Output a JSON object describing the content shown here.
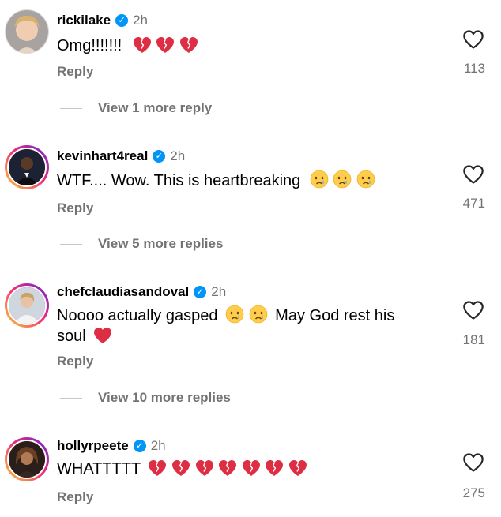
{
  "comments": [
    {
      "username": "rickilake",
      "verified_icon": "verified-badge-icon",
      "time": "2h",
      "text": "Omg!!!!!!!",
      "emoji": "broken-heart-icon",
      "emoji_count": 3,
      "reply_label": "Reply",
      "likes": "113",
      "view_more": "View 1 more reply"
    },
    {
      "username": "kevinhart4real",
      "verified_icon": "verified-badge-icon",
      "time": "2h",
      "text": "WTF.... Wow. This is heartbreaking",
      "emoji": "crying-face-icon",
      "emoji_count": 3,
      "reply_label": "Reply",
      "likes": "471",
      "view_more": "View 5 more replies"
    },
    {
      "username": "chefclaudiasandoval",
      "verified_icon": "verified-badge-icon",
      "time": "2h",
      "text_a": "Noooo actually gasped",
      "text_b": "May God rest his",
      "text_c": "soul",
      "emoji": "crying-face-icon",
      "emoji_count": 2,
      "end_emoji": "red-heart-icon",
      "reply_label": "Reply",
      "likes": "181",
      "view_more": "View 10 more replies"
    },
    {
      "username": "hollyrpeete",
      "verified_icon": "verified-badge-icon",
      "time": "2h",
      "text": "WHATTTTT",
      "emoji": "broken-heart-icon",
      "emoji_count": 7,
      "reply_label": "Reply",
      "likes": "275"
    }
  ],
  "colors": {
    "muted": "#737373",
    "verified": "#0095f6",
    "heart_red": "#dd2e44"
  }
}
